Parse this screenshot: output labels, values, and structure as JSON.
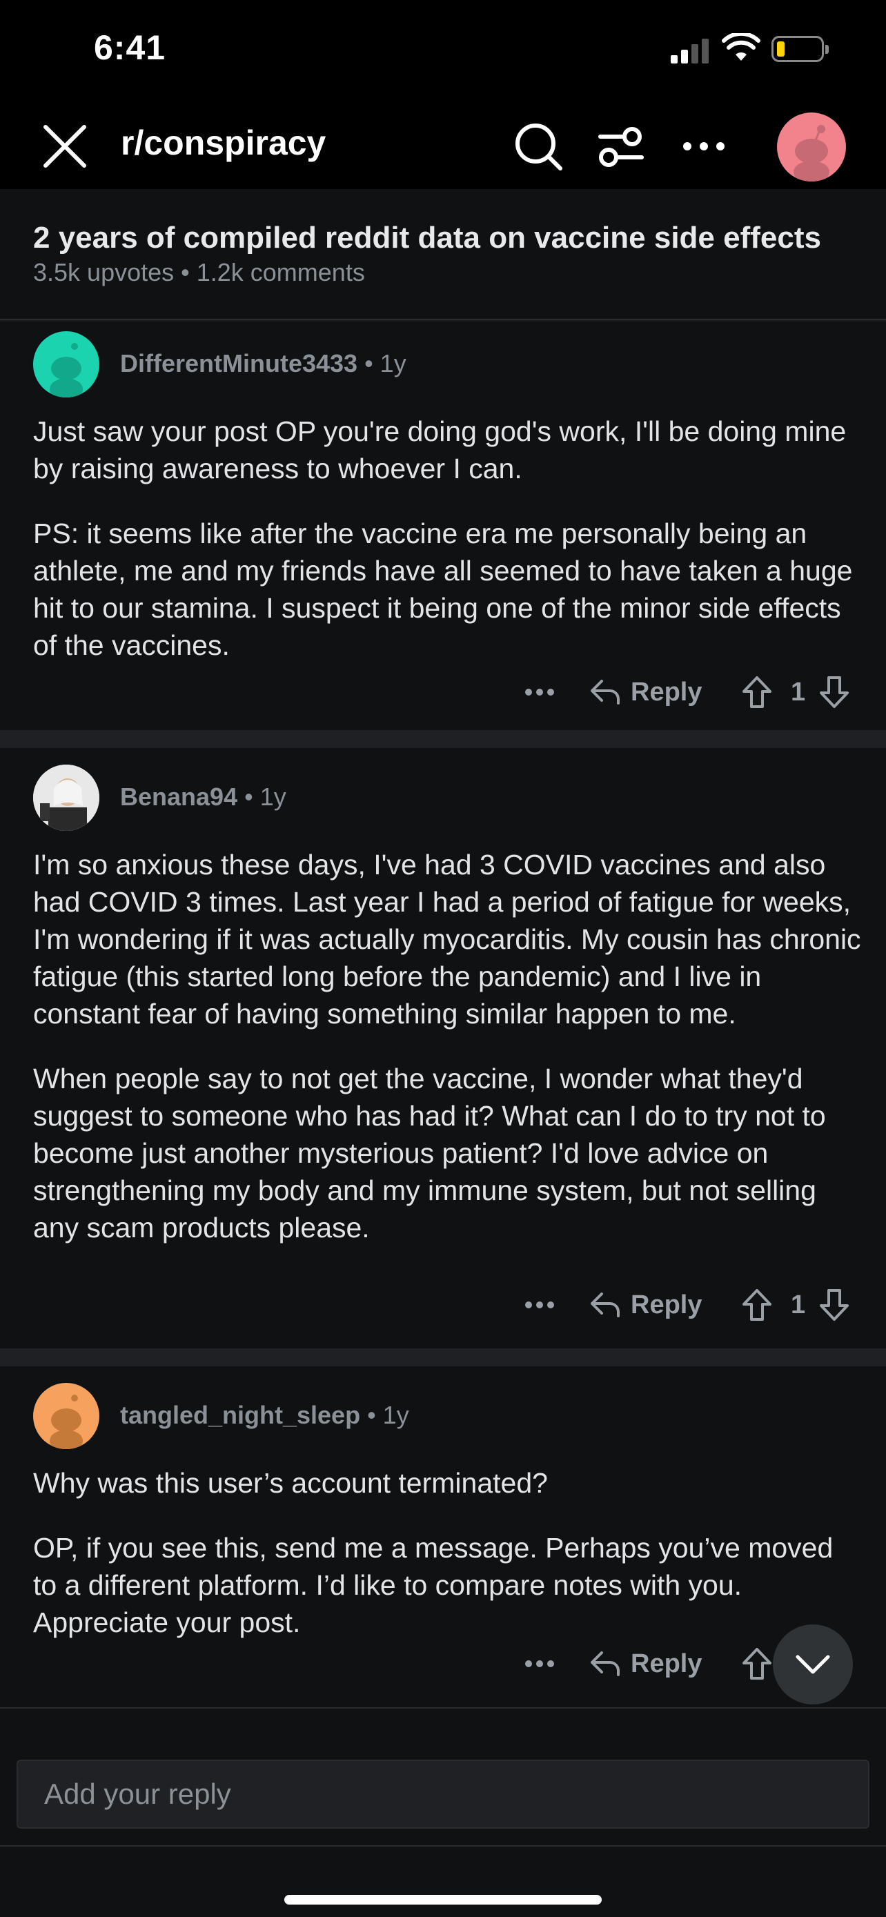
{
  "status_bar": {
    "time": "6:41"
  },
  "nav": {
    "title": "r/conspiracy",
    "icons": [
      "close-icon",
      "search-icon",
      "filter-icon",
      "more-icon",
      "avatar"
    ]
  },
  "post": {
    "title": "2 years of compiled reddit data on vaccine side effects",
    "meta": "3.5k upvotes • 1.2k comments"
  },
  "comments": [
    {
      "user": "DifferentMinute3433",
      "age": " • 1y",
      "avatar_color": "#1cd3b0",
      "paragraphs": [
        "Just saw your post OP you're doing god's work, I'll be doing mine by raising awareness to whoever I can.",
        "PS: it seems like after the vaccine era me personally being an athlete, me and my friends have all seemed to have taken a huge hit to our stamina. I suspect it being one of the minor side effects of the vaccines."
      ],
      "reply_label": "Reply",
      "score": "1"
    },
    {
      "user": "Benana94",
      "age": " • 1y",
      "avatar_color": "#c9c9c9",
      "paragraphs": [
        "I'm so anxious these days, I've had 3 COVID vaccines and also had COVID 3 times. Last year I had a period of fatigue for weeks, I'm wondering if it was actually myocarditis. My cousin has chronic fatigue (this started long before the pandemic) and I live in constant fear of having something similar happen to me.",
        "When people say to not get the vaccine, I wonder what they'd suggest to someone who has had it? What can I do to try not to become just another mysterious patient? I'd love advice on strengthening my body and my immune system, but not selling any scam products please."
      ],
      "reply_label": "Reply",
      "score": "1"
    },
    {
      "user": "tangled_night_sleep",
      "age": " • 1y",
      "avatar_color": "#f6a25e",
      "paragraphs": [
        "Why was this user’s account terminated?",
        "OP, if you see this, send me a message. Perhaps you’ve moved to a different platform. I’d like to compare notes with you. Appreciate your post."
      ],
      "reply_label": "Reply",
      "score": ""
    }
  ],
  "reply_bar": {
    "placeholder": "Add your reply"
  },
  "colors": {
    "background": "#000000",
    "card": "#0f1113",
    "separator": "#1e2023",
    "text": "#e2e4e6",
    "muted": "#8b9196",
    "nav_avatar": "#f2838d"
  }
}
